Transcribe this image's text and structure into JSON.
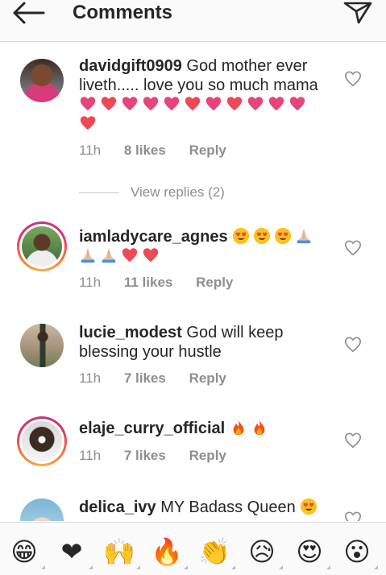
{
  "header": {
    "title": "Comments",
    "back_icon": "arrow-left-icon",
    "send_icon": "paper-plane-icon"
  },
  "comments": [
    {
      "username": "davidgift0909",
      "text": "God mother ever liveth..... love you so much mama",
      "emojis": [
        "pink-heart",
        "red-heart",
        "pink-heart",
        "pink-heart",
        "pink-heart",
        "red-heart",
        "pink-heart",
        "red-heart",
        "pink-heart",
        "pink-heart",
        "pink-heart",
        "red-heart"
      ],
      "time": "11h",
      "likes": "8 likes",
      "reply": "Reply",
      "story_ring": false
    },
    {
      "username": "iamladycare_agnes",
      "text": "",
      "emojis": [
        "heart-eyes",
        "heart-eyes",
        "heart-eyes",
        "folded-hands",
        "folded-hands",
        "folded-hands",
        "red-heart",
        "red-heart"
      ],
      "time": "11h",
      "likes": "11 likes",
      "reply": "Reply",
      "story_ring": true
    },
    {
      "username": "lucie_modest",
      "text": "God will keep blessing your hustle",
      "emojis": [],
      "time": "11h",
      "likes": "7 likes",
      "reply": "Reply",
      "story_ring": false
    },
    {
      "username": "elaje_curry_official",
      "text": "",
      "emojis": [
        "fire",
        "fire"
      ],
      "time": "11h",
      "likes": "7 likes",
      "reply": "Reply",
      "story_ring": true
    },
    {
      "username": "delica_ivy",
      "text": "MY Badass Queen",
      "emojis": [
        "heart-eyes"
      ],
      "time": "",
      "likes": "",
      "reply": "",
      "story_ring": false
    }
  ],
  "view_replies": "View replies (2)",
  "emoji_bar": [
    {
      "name": "grinning-face-icon",
      "glyph": "😁"
    },
    {
      "name": "red-heart-icon",
      "glyph": "❤"
    },
    {
      "name": "raising-hands-icon",
      "glyph": "🙌"
    },
    {
      "name": "fire-icon",
      "glyph": "🔥"
    },
    {
      "name": "clapping-hands-icon",
      "glyph": "👏"
    },
    {
      "name": "sad-face-icon",
      "glyph": "😥"
    },
    {
      "name": "heart-eyes-icon",
      "glyph": "😍"
    },
    {
      "name": "surprised-face-icon",
      "glyph": "😮"
    }
  ],
  "colors": {
    "text": "#262626",
    "meta": "#8e8e8e",
    "red_heart": "#ed4956",
    "pink_heart": "#e6447a"
  }
}
